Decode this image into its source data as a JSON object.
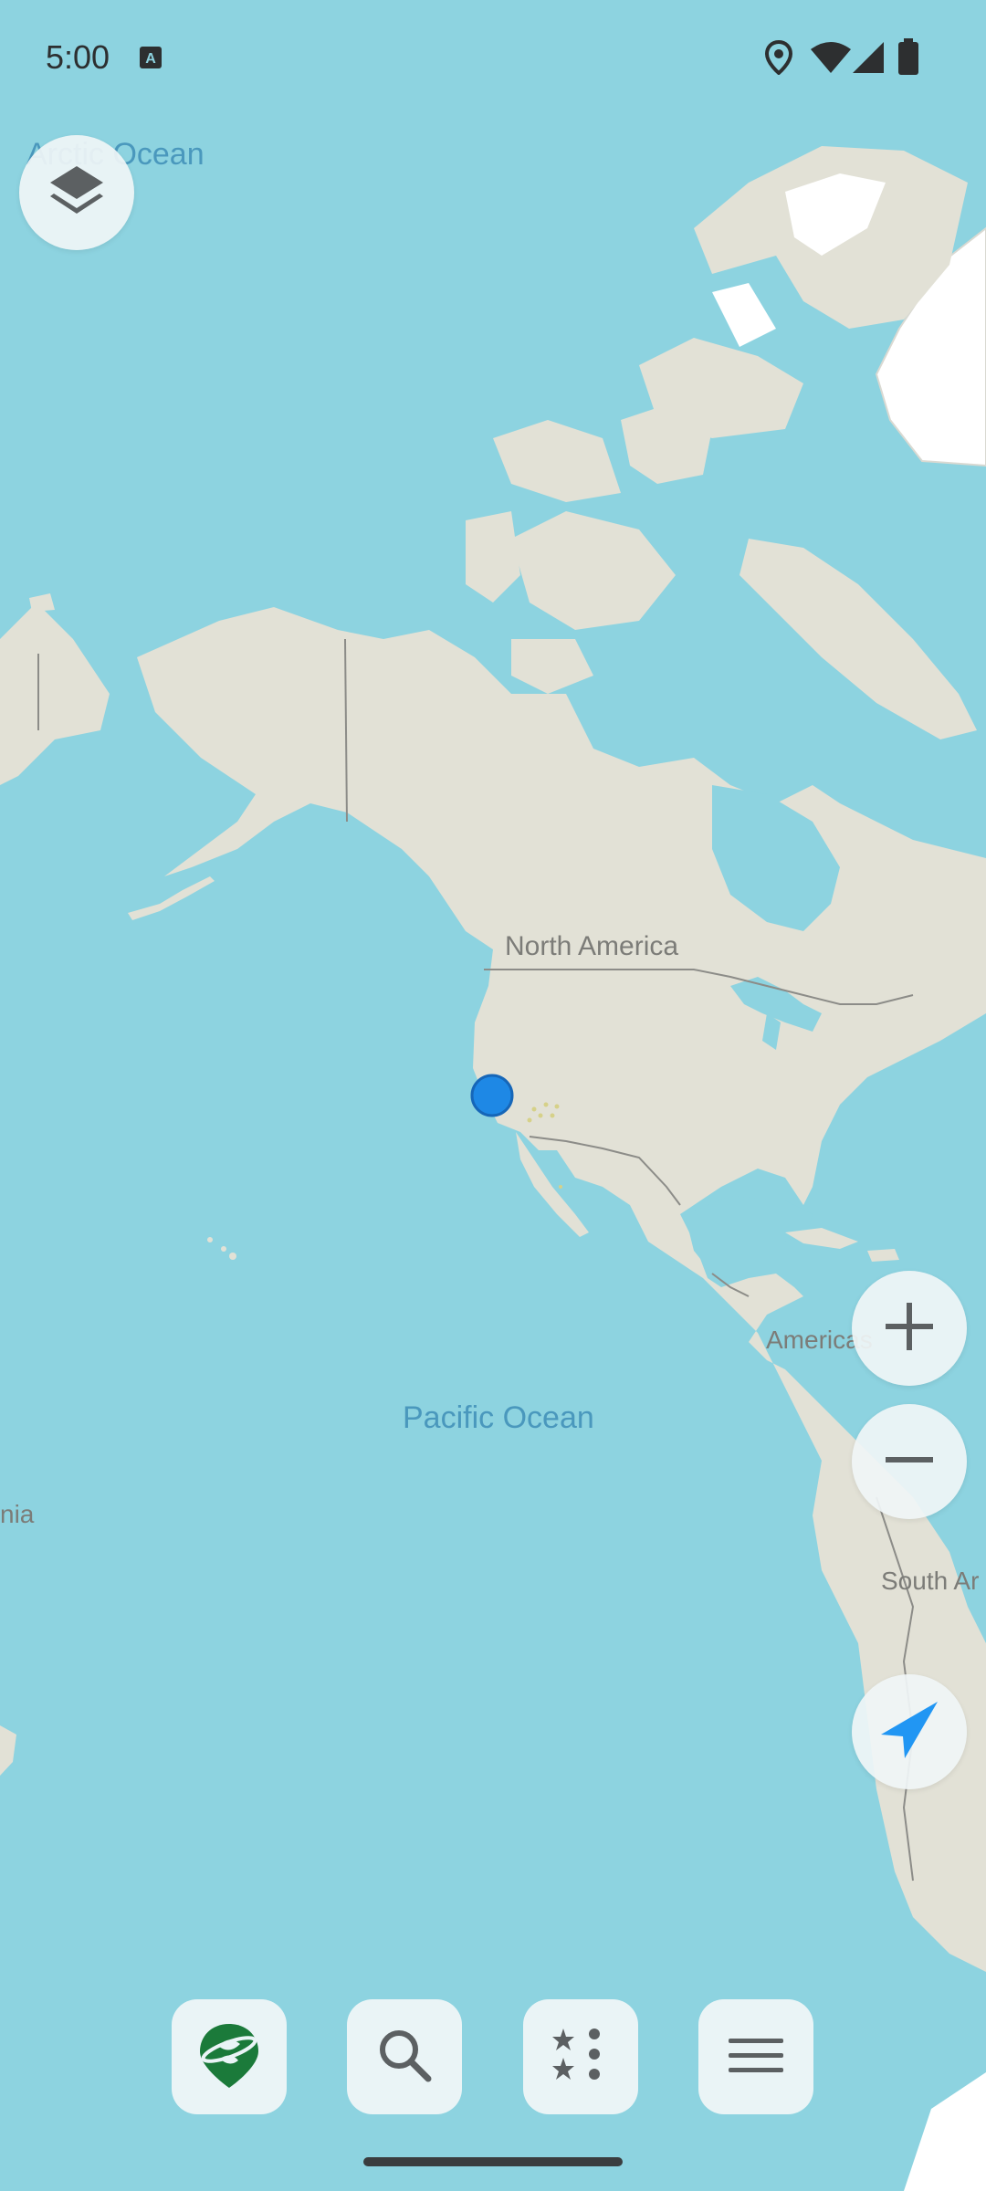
{
  "status_bar": {
    "time": "5:00",
    "icons": [
      "keyboard-a-icon",
      "location-icon",
      "wifi-icon",
      "signal-icon",
      "battery-icon"
    ]
  },
  "map": {
    "labels": {
      "arctic_ocean": "Arctic Ocean",
      "north_america": "North America",
      "americas": "Americas",
      "pacific_ocean": "Pacific Ocean",
      "oceania_partial": "nia",
      "south_america_partial": "South Ar"
    },
    "colors": {
      "water": "#8dd3e0",
      "land": "#e2e1d6",
      "ice": "#ffffff",
      "border": "#8c8c88",
      "location_dot": "#1e88e5"
    }
  },
  "controls": {
    "layers_button": "layers-icon",
    "zoom_in_button": "plus-icon",
    "zoom_out_button": "minus-icon",
    "my_location_button": "navigation-arrow-icon"
  },
  "bottom_nav": {
    "items": [
      "app-logo-icon",
      "search-icon",
      "favorites-icon",
      "menu-icon"
    ]
  }
}
